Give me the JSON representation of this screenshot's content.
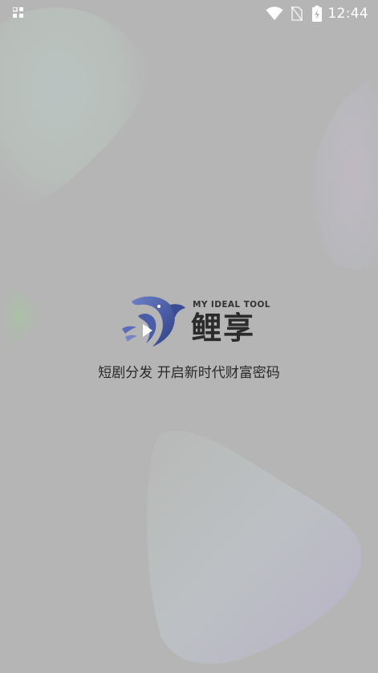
{
  "status_bar": {
    "time": "12:44",
    "left_icon": "app-grid-icon",
    "icons": [
      "wifi-icon",
      "no-sim-icon",
      "battery-charging-icon"
    ]
  },
  "splash": {
    "logo_icon": "fish-play-logo-icon",
    "brand_en": "MY IDEAL TOOL",
    "brand_cn": "鲤享",
    "slogan": "短剧分发 开启新时代财富密码"
  },
  "colors": {
    "background": "#b5b5b5",
    "logo_blue": "#5b6db8",
    "logo_dark": "#2a3a7a",
    "text_dark": "#2a2a2a"
  }
}
